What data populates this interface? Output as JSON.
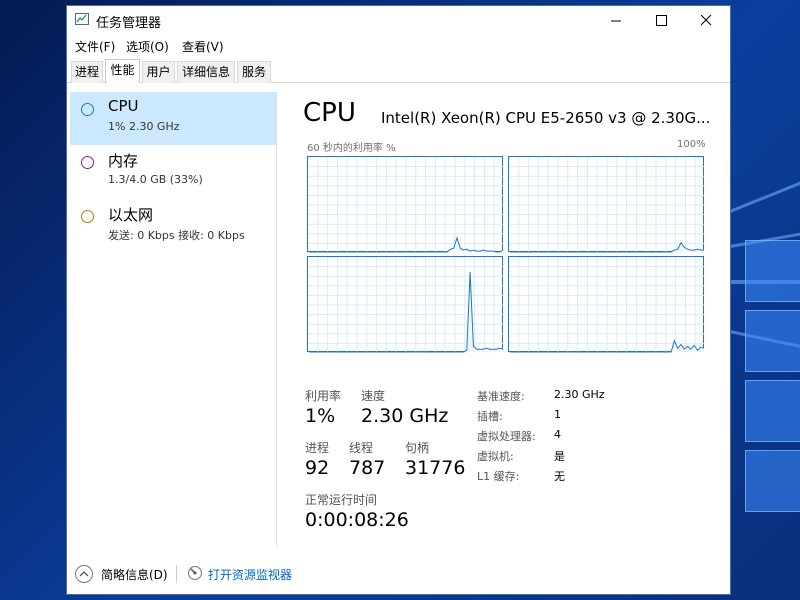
{
  "window": {
    "title": "任务管理器"
  },
  "menu": [
    "文件(F)",
    "选项(O)",
    "查看(V)"
  ],
  "tabs": [
    {
      "label": "进程",
      "active": false
    },
    {
      "label": "性能",
      "active": true
    },
    {
      "label": "用户",
      "active": false
    },
    {
      "label": "详细信息",
      "active": false
    },
    {
      "label": "服务",
      "active": false
    }
  ],
  "sidebar": [
    {
      "title": "CPU",
      "subtitle": "1% 2.30 GHz",
      "color": "#1a77c9",
      "selected": true
    },
    {
      "title": "内存",
      "subtitle": "1.3/4.0 GB (33%)",
      "color": "#8b18a8",
      "selected": false
    },
    {
      "title": "以太网",
      "subtitle": "发送: 0 Kbps  接收: 0 Kbps",
      "color": "#c8741c",
      "selected": false
    }
  ],
  "main": {
    "title": "CPU",
    "model": "Intel(R) Xeon(R) CPU E5-2650 v3 @ 2.30G...",
    "graph_label_left": "60 秒内的利用率 %",
    "graph_label_right": "100%"
  },
  "stats": {
    "utilization_label": "利用率",
    "utilization_value": "1%",
    "speed_label": "速度",
    "speed_value": "2.30 GHz",
    "processes_label": "进程",
    "processes_value": "92",
    "threads_label": "线程",
    "threads_value": "787",
    "handles_label": "句柄",
    "handles_value": "31776",
    "uptime_label": "正常运行时间",
    "uptime_value": "0:00:08:26"
  },
  "specs": [
    {
      "label": "基准速度:",
      "value": "2.30 GHz"
    },
    {
      "label": "插槽:",
      "value": "1"
    },
    {
      "label": "虚拟处理器:",
      "value": "4"
    },
    {
      "label": "虚拟机:",
      "value": "是"
    },
    {
      "label": "L1 缓存:",
      "value": "无"
    }
  ],
  "footer": {
    "brief_label": "简略信息(D)",
    "resource_monitor_link": "打开资源监视器"
  },
  "colors": {
    "accent": "#1a77c9",
    "selection": "#cce8ff",
    "link": "#0066cc"
  },
  "chart_data": {
    "type": "line",
    "title": "",
    "ylim": [
      0,
      100
    ],
    "series": [
      {
        "values": [
          0,
          0,
          0,
          0,
          0,
          0,
          0,
          0,
          0,
          0,
          0,
          0,
          0,
          0,
          0,
          0,
          0,
          0,
          0,
          0,
          0,
          0,
          0,
          0,
          0,
          0,
          0,
          0,
          0,
          0,
          0,
          0,
          0,
          0,
          0,
          0,
          0,
          0,
          0,
          0,
          0,
          0,
          0,
          3,
          4,
          15,
          4,
          2,
          3,
          1,
          2,
          1,
          1,
          2,
          1,
          1,
          1,
          0,
          0,
          2
        ]
      },
      {
        "values": [
          0,
          0,
          0,
          0,
          0,
          0,
          0,
          0,
          0,
          0,
          0,
          0,
          0,
          0,
          0,
          0,
          0,
          0,
          0,
          0,
          0,
          0,
          0,
          0,
          0,
          0,
          0,
          0,
          0,
          0,
          0,
          0,
          0,
          0,
          0,
          0,
          0,
          0,
          0,
          0,
          0,
          0,
          0,
          0,
          0,
          0,
          0,
          0,
          0,
          0,
          2,
          3,
          10,
          5,
          3,
          2,
          2,
          3,
          2,
          2
        ]
      },
      {
        "values": [
          0,
          0,
          0,
          0,
          0,
          0,
          0,
          0,
          0,
          0,
          0,
          0,
          0,
          0,
          0,
          0,
          0,
          0,
          0,
          0,
          0,
          0,
          0,
          0,
          0,
          0,
          0,
          0,
          0,
          0,
          0,
          0,
          0,
          0,
          0,
          0,
          0,
          0,
          0,
          0,
          0,
          0,
          0,
          0,
          0,
          0,
          0,
          0,
          2,
          85,
          6,
          3,
          3,
          3,
          4,
          3,
          3,
          3,
          4,
          3
        ]
      },
      {
        "values": [
          0,
          0,
          0,
          0,
          0,
          0,
          0,
          0,
          0,
          0,
          0,
          0,
          0,
          0,
          0,
          0,
          0,
          0,
          0,
          0,
          0,
          0,
          0,
          0,
          0,
          0,
          0,
          0,
          0,
          0,
          0,
          0,
          0,
          0,
          0,
          0,
          0,
          0,
          0,
          0,
          0,
          0,
          0,
          0,
          0,
          0,
          0,
          0,
          0,
          0,
          12,
          4,
          8,
          3,
          6,
          3,
          7,
          2,
          5,
          4
        ]
      }
    ]
  }
}
